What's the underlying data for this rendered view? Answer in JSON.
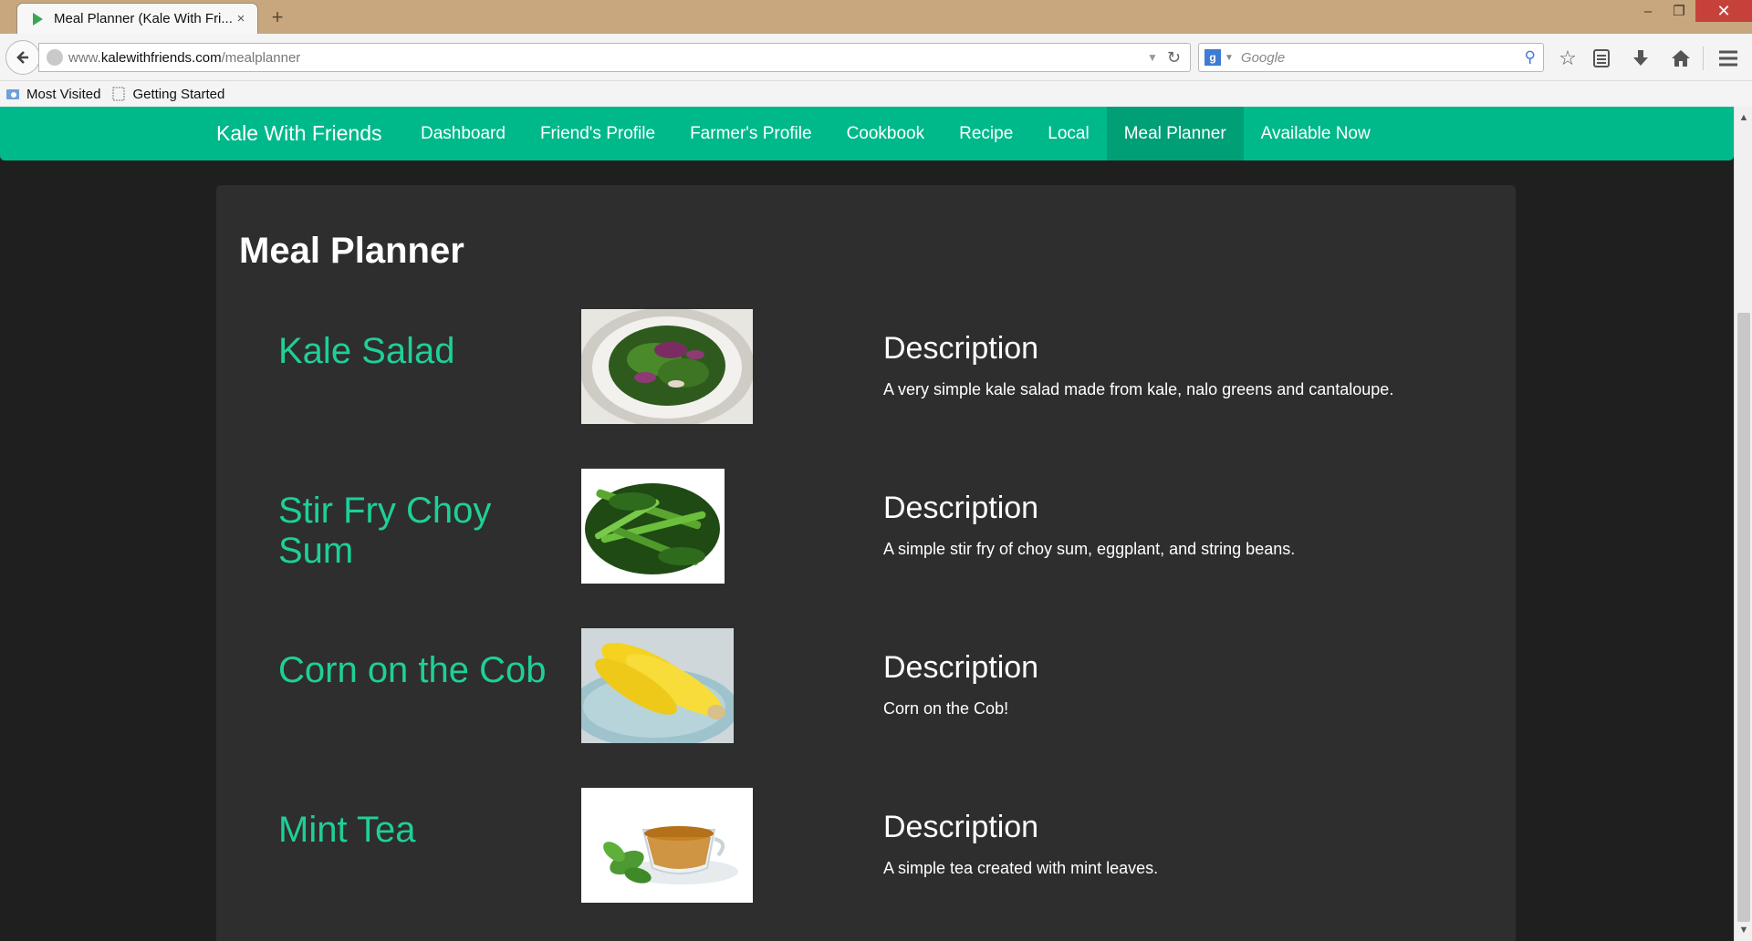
{
  "browser": {
    "tab_title": "Meal Planner (Kale With Fri...",
    "tab_close": "×",
    "new_tab": "+",
    "window_controls": {
      "minimize": "‒",
      "maximize": "❐",
      "close": "✕"
    },
    "url_prefix": "www.",
    "url_host": "kalewithfriends.com",
    "url_path": "/mealplanner",
    "search_placeholder": "Google",
    "bookmarks": [
      "Most Visited",
      "Getting Started"
    ]
  },
  "site": {
    "brand": "Kale With Friends",
    "accent_color": "#00b98b",
    "active_color": "#009f76",
    "heading_color": "#1fcf98",
    "nav": [
      {
        "label": "Dashboard",
        "active": false
      },
      {
        "label": "Friend's Profile",
        "active": false
      },
      {
        "label": "Farmer's Profile",
        "active": false
      },
      {
        "label": "Cookbook",
        "active": false
      },
      {
        "label": "Recipe",
        "active": false
      },
      {
        "label": "Local",
        "active": false
      },
      {
        "label": "Meal Planner",
        "active": true
      },
      {
        "label": "Available Now",
        "active": false
      }
    ]
  },
  "page": {
    "title": "Meal Planner",
    "meals": [
      {
        "name": "Kale Salad",
        "image": "kale-salad-photo",
        "desc_heading": "Description",
        "description": "A very simple kale salad made from kale, nalo greens and cantaloupe."
      },
      {
        "name": "Stir Fry Choy Sum",
        "image": "choy-sum-photo",
        "desc_heading": "Description",
        "description": "A simple stir fry of choy sum, eggplant, and string beans."
      },
      {
        "name": "Corn on the Cob",
        "image": "corn-photo",
        "desc_heading": "Description",
        "description": "Corn on the Cob!"
      },
      {
        "name": "Mint Tea",
        "image": "mint-tea-photo",
        "desc_heading": "Description",
        "description": "A simple tea created with mint leaves."
      }
    ]
  }
}
